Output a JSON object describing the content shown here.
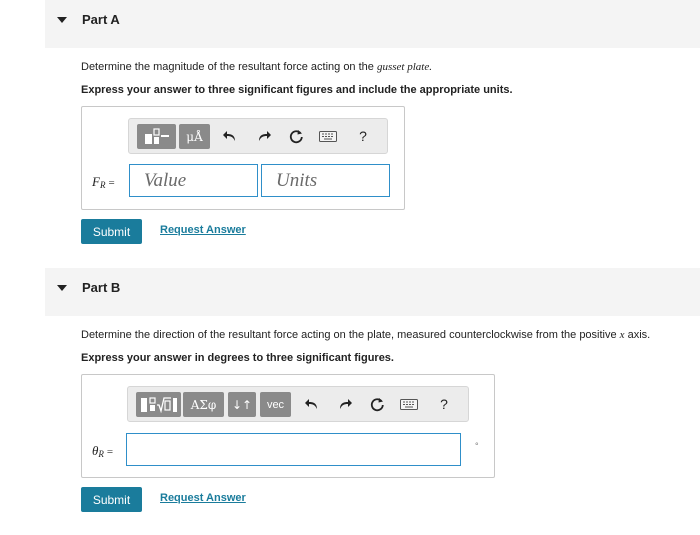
{
  "part_a": {
    "title": "Part A",
    "question_prefix": "Determine the magnitude of the resultant force acting on the ",
    "question_italic": "gusset plate.",
    "instruction": "Express your answer to three significant figures and include the appropriate units.",
    "toolbar": {
      "units_label": "μÅ",
      "help_label": "?"
    },
    "var_main": "F",
    "var_sub": "R",
    "var_eq": "=",
    "value_placeholder": "Value",
    "units_placeholder": "Units",
    "submit_label": "Submit",
    "request_label": "Request Answer"
  },
  "part_b": {
    "title": "Part B",
    "question_prefix": "Determine the direction of the resultant force acting on the plate, measured counterclockwise from the positive ",
    "question_var": "x",
    "question_suffix": " axis.",
    "instruction": "Express your answer in degrees to three significant figures.",
    "toolbar": {
      "greek_label": "ΑΣφ",
      "arrows_label": "↓↑",
      "vec_label": "vec",
      "help_label": "?"
    },
    "var_main": "θ",
    "var_sub": "R",
    "var_eq": "=",
    "unit_symbol": "°",
    "submit_label": "Submit",
    "request_label": "Request Answer"
  },
  "colors": {
    "accent": "#1a7c9c",
    "input_border": "#2f8fc9",
    "header_bg": "#f4f4f4",
    "button_gray": "#8a8a8a"
  },
  "icons": [
    "caret-down-icon",
    "templates-icon",
    "undo-icon",
    "redo-icon",
    "reset-icon",
    "keyboard-icon",
    "help-icon"
  ]
}
